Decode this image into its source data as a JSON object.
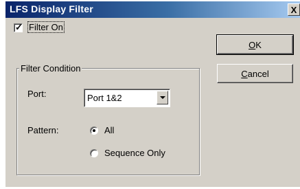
{
  "window": {
    "title": "LFS Display Filter",
    "close_glyph": "X"
  },
  "filter_on": {
    "label": "Filter On",
    "checked": true,
    "check_glyph": "✓"
  },
  "filter_condition": {
    "title": "Filter Condition",
    "port": {
      "label": "Port:",
      "selected": "Port 1&2"
    },
    "pattern": {
      "label": "Pattern:",
      "options": [
        {
          "label": "All",
          "selected": true
        },
        {
          "label": "Sequence Only",
          "selected": false
        }
      ]
    }
  },
  "buttons": {
    "ok_mnemonic": "O",
    "ok_rest": "K",
    "cancel_mnemonic": "C",
    "cancel_rest": "ancel"
  },
  "colors": {
    "titlebar_start": "#0a246a",
    "titlebar_end": "#a6caf0",
    "dialog_face": "#d4d0c8"
  }
}
